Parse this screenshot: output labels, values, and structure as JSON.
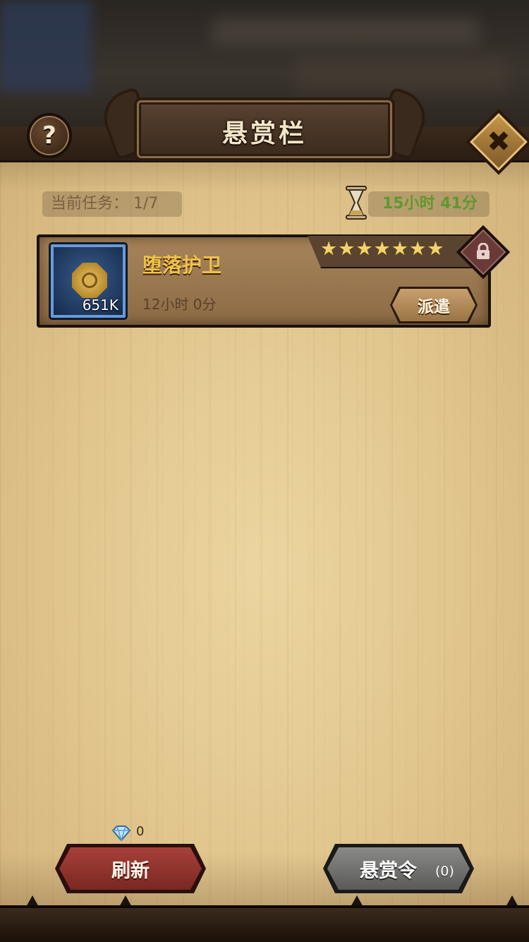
{
  "header": {
    "title": "悬赏栏",
    "help_label": "?",
    "close_label": "✖"
  },
  "info": {
    "current_tasks": "当前任务： 1/7",
    "refresh_timer": "15小时 41分"
  },
  "quests": [
    {
      "name": "堕落护卫",
      "duration": "12小时 0分",
      "reward_count": "651K",
      "reward_icon": "gold-coin-icon",
      "stars": 7,
      "star_glyph": "★",
      "locked": true,
      "dispatch_label": "派遣"
    }
  ],
  "footer": {
    "gem_count": "0",
    "refresh_label": "刷新",
    "bounty_label": "悬赏令",
    "bounty_count": "(0)"
  },
  "colors": {
    "parchment": "#e6cc96",
    "quest_name": "#f0c24a",
    "timer": "#5c9a2e",
    "refresh_button": "#9a3a34",
    "bounty_button": "#7a7a78",
    "reward_frame": "#6a9ad8"
  }
}
